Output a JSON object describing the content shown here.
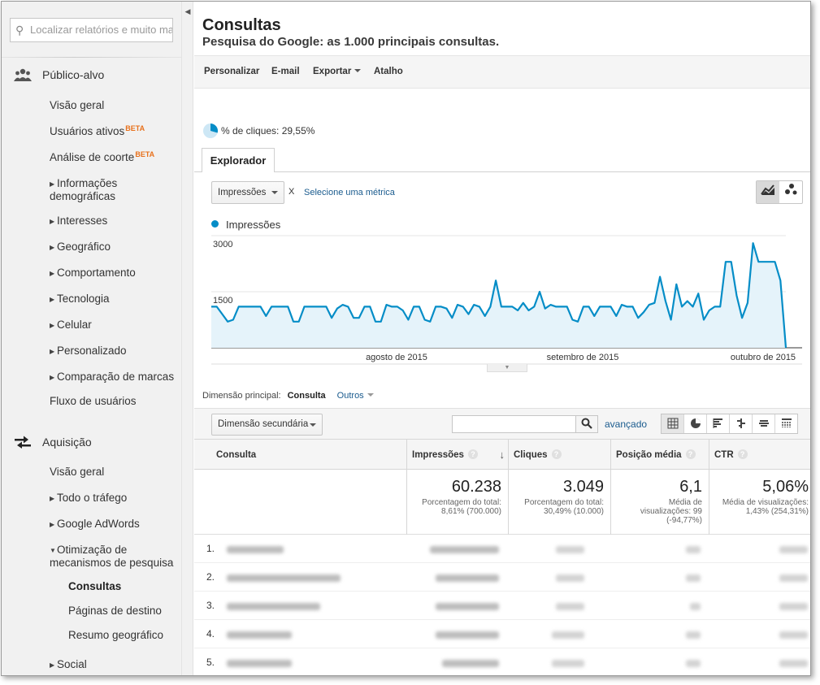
{
  "sidebar": {
    "search_placeholder": "Localizar relatórios e muito mais",
    "audience": {
      "label": "Público-alvo",
      "items": [
        "Visão geral",
        "Usuários ativos",
        "Análise de coorte",
        "Informações demográficas",
        "Interesses",
        "Geográfico",
        "Comportamento",
        "Tecnologia",
        "Celular",
        "Personalizado",
        "Comparação de marcas",
        "Fluxo de usuários"
      ],
      "beta_label": "BETA"
    },
    "acquisition": {
      "label": "Aquisição",
      "items": [
        "Visão geral",
        "Todo o tráfego",
        "Google AdWords",
        "Otimização de mecanismos de pesquisa",
        "Consultas",
        "Páginas de destino",
        "Resumo geográfico",
        "Social"
      ]
    }
  },
  "header": {
    "title": "Consultas",
    "subtitle": "Pesquisa do Google: as 1.000 principais consultas."
  },
  "toolbar": {
    "customize": "Personalizar",
    "email": "E-mail",
    "export": "Exportar",
    "shortcut": "Atalho"
  },
  "summary": {
    "clicks_pct_label": "% de cliques: 29,55%",
    "clicks_pct_value": 0.2955
  },
  "explorer": {
    "tab_label": "Explorador",
    "metric_select": "Impressões",
    "remove_mark": "X",
    "select_metric": "Selecione uma métrica"
  },
  "chart_data": {
    "type": "area",
    "series": [
      {
        "name": "Impressões",
        "color": "#058dc7",
        "values": [
          1100,
          1100,
          900,
          700,
          750,
          1100,
          1100,
          1100,
          1100,
          1100,
          850,
          1100,
          1100,
          1100,
          1100,
          700,
          700,
          1100,
          1100,
          1100,
          1100,
          1100,
          800,
          1050,
          1150,
          1100,
          800,
          800,
          1100,
          1100,
          700,
          700,
          1150,
          1100,
          1100,
          1000,
          750,
          1100,
          1100,
          750,
          700,
          1100,
          1100,
          1050,
          800,
          1150,
          1100,
          900,
          1150,
          1100,
          850,
          1100,
          1800,
          1100,
          1100,
          1100,
          1000,
          1200,
          1000,
          1100,
          1500,
          1050,
          1150,
          1100,
          1100,
          1100,
          750,
          700,
          1100,
          1100,
          850,
          1100,
          1100,
          1100,
          850,
          1150,
          1100,
          1100,
          800,
          950,
          1150,
          1200,
          1900,
          1250,
          750,
          1700,
          1100,
          1250,
          1100,
          1450,
          750,
          1000,
          1100,
          1100,
          2300,
          2300,
          1400,
          800,
          1200,
          2800,
          2300,
          2300,
          2300,
          2300,
          1800,
          0
        ]
      }
    ],
    "x_tick_labels": [
      "agosto de 2015",
      "setembro de 2015",
      "outubro de 2015"
    ],
    "y_tick_labels": [
      "3000",
      "1500"
    ],
    "ylim": [
      0,
      3000
    ],
    "grid": true
  },
  "table": {
    "primary_dimension_label": "Dimensão principal:",
    "primary_dimension_value": "Consulta",
    "other_label": "Outros",
    "secondary_dimension": "Dimensão secundária",
    "advanced_label": "avançado",
    "columns": [
      "Consulta",
      "Impressões",
      "Cliques",
      "Posição média",
      "CTR"
    ],
    "totals": [
      {
        "value": "60.238",
        "lines": [
          "Porcentagem do total:",
          "8,61% (700.000)"
        ]
      },
      {
        "value": "3.049",
        "lines": [
          "Porcentagem do total:",
          "30,49% (10.000)"
        ]
      },
      {
        "value": "6,1",
        "lines": [
          "Média de",
          "visualizações: 99",
          "(-94,77%)"
        ]
      },
      {
        "value": "5,06%",
        "lines": [
          "Média de visualizações:",
          "1,43% (254,31%)"
        ]
      }
    ],
    "row_numbers": [
      "1.",
      "2.",
      "3.",
      "4.",
      "5."
    ]
  }
}
